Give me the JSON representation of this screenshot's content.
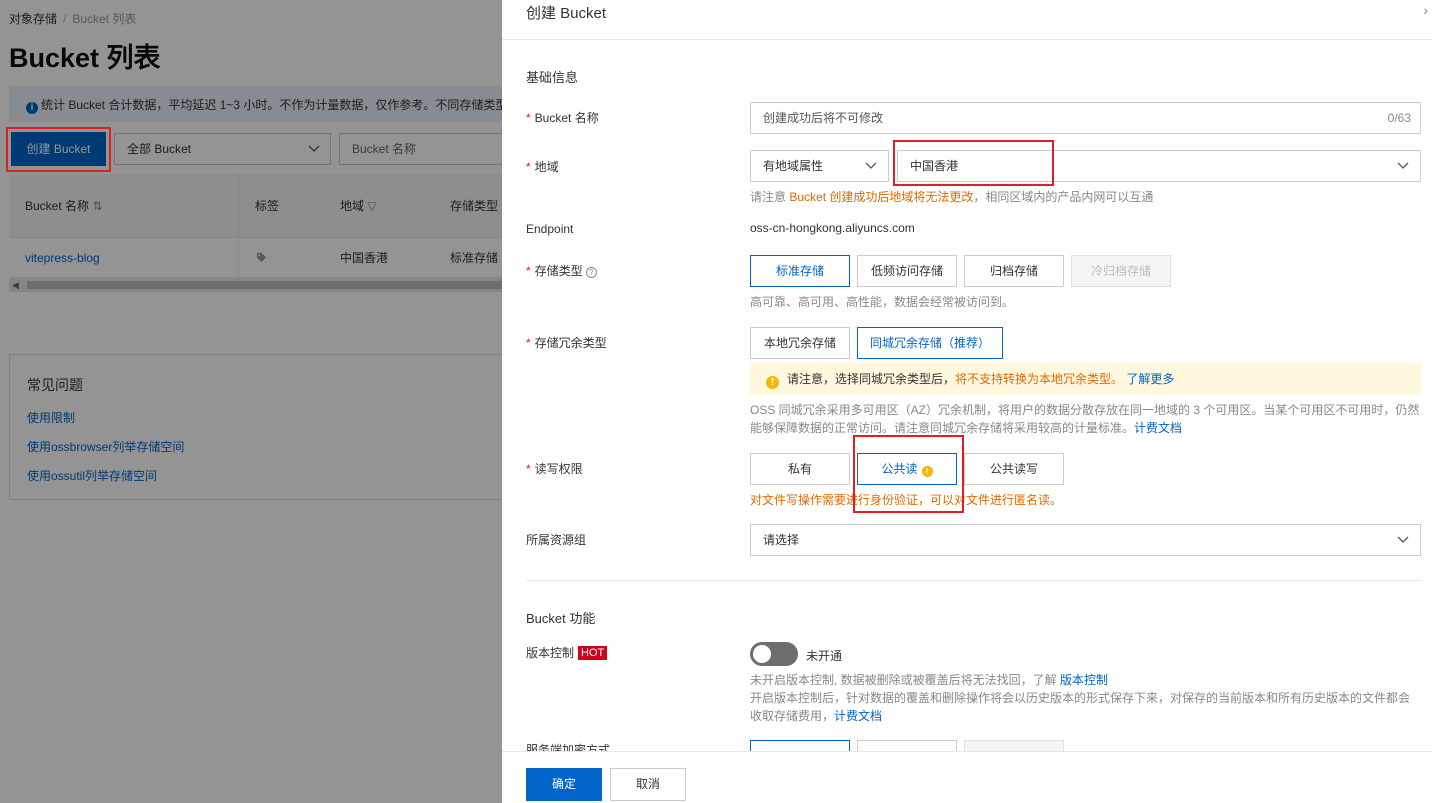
{
  "background": {
    "breadcrumb": {
      "root": "对象存储",
      "separator": "/",
      "current": "Bucket 列表"
    },
    "page_title": "Bucket 列表",
    "info_text": "统计 Bucket 合计数据，平均延迟 1~3 小时。不作为计量数据，仅作参考。不同存储类型",
    "create_button": "创建 Bucket",
    "filter_select": "全部 Bucket",
    "search_placeholder": "Bucket 名称",
    "table": {
      "headers": [
        "Bucket 名称",
        "标签",
        "地域",
        "存储类型"
      ],
      "rows": [
        {
          "name": "vitepress-blog",
          "region": "中国香港",
          "storage": "标准存储"
        }
      ]
    },
    "faq": {
      "title": "常见问题",
      "links": [
        "使用限制",
        "使用ossbrowser列举存储空间",
        "使用ossutil列举存储空间"
      ]
    }
  },
  "drawer": {
    "title": "创建 Bucket",
    "basic_section": "基础信息",
    "name": {
      "label": "Bucket 名称",
      "placeholder": "创建成功后将不可修改",
      "counter": "0/63"
    },
    "region": {
      "label": "地域",
      "attr_select": "有地域属性",
      "region_select": "中国香港",
      "hint_pre": "请注意 ",
      "hint_warn": "Bucket 创建成功后地域将无法更改",
      "hint_post": "，相同区域内的产品内网可以互通"
    },
    "endpoint": {
      "label": "Endpoint",
      "value": "oss-cn-hongkong.aliyuncs.com"
    },
    "storage_class": {
      "label": "存储类型",
      "options": [
        "标准存储",
        "低频访问存储",
        "归档存储",
        "冷归档存储"
      ],
      "selected": "标准存储",
      "hint": "高可靠、高可用、高性能，数据会经常被访问到。"
    },
    "redundancy": {
      "label": "存储冗余类型",
      "options": [
        "本地冗余存储",
        "同城冗余存储（推荐）"
      ],
      "selected": "同城冗余存储（推荐）",
      "notice_pre": "请注意，选择同城冗余类型后，",
      "notice_warn": "将不支持转换为本地冗余类型。",
      "notice_link": "了解更多",
      "desc": "OSS 同城冗余采用多可用区（AZ）冗余机制，将用户的数据分散存放在同一地域的 3 个可用区。当某个可用区不可用时，仍然能够保障数据的正常访问。请注意同城冗余存储将采用较高的计量标准。",
      "desc_link": "计费文档"
    },
    "acl": {
      "label": "读写权限",
      "options": [
        "私有",
        "公共读",
        "公共读写"
      ],
      "selected": "公共读",
      "warning": "对文件写操作需要进行身份验证，可以对文件进行匿名读。"
    },
    "resource_group": {
      "label": "所属资源组",
      "placeholder": "请选择"
    },
    "function_section": "Bucket 功能",
    "versioning": {
      "label": "版本控制",
      "badge": "HOT",
      "state": "未开通",
      "desc1": "未开启版本控制, 数据被删除或被覆盖后将无法找回，了解 ",
      "desc1_link": "版本控制",
      "desc2": "开启版本控制后，针对数据的覆盖和删除操作将会以历史版本的形式保存下来，对保存的当前版本和所有历史版本的文件都会收取存储费用，",
      "desc2_link": "计费文档"
    },
    "encryption": {
      "label": "服务端加密方式"
    },
    "ok_button": "确定",
    "cancel_button": "取消"
  },
  "colors": {
    "primary": "#0064c8",
    "highlight_border": "#e02020",
    "warning_text": "#e06b00"
  }
}
